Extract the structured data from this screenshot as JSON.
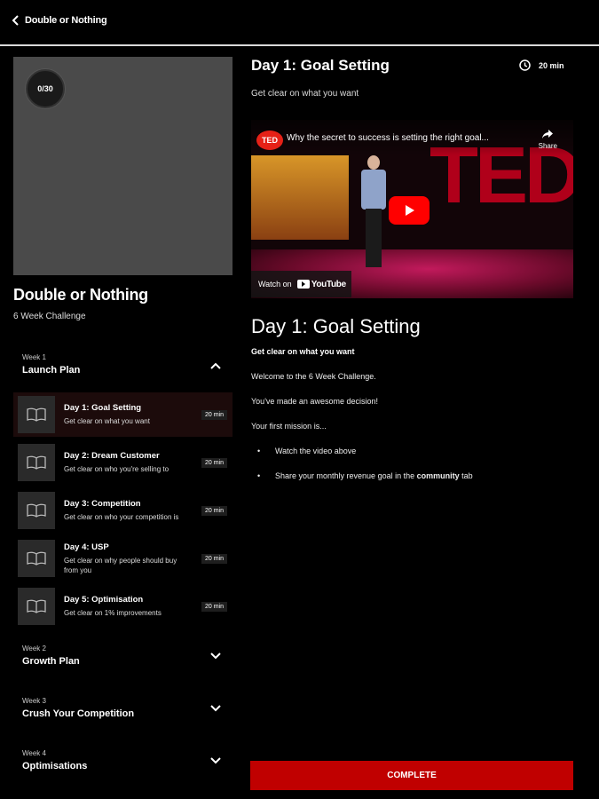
{
  "header": {
    "back_label": "Double or Nothing"
  },
  "course": {
    "progress_label": "0/30",
    "title": "Double or Nothing",
    "subtitle": "6 Week Challenge"
  },
  "weeks": [
    {
      "num": "Week 1",
      "name": "Launch Plan",
      "expanded": true
    },
    {
      "num": "Week 2",
      "name": "Growth Plan",
      "expanded": false
    },
    {
      "num": "Week 3",
      "name": "Crush Your Competition",
      "expanded": false
    },
    {
      "num": "Week 4",
      "name": "Optimisations",
      "expanded": false
    }
  ],
  "lessons": [
    {
      "title": "Day 1: Goal Setting",
      "desc": "Get clear on what you want",
      "duration": "20 min",
      "active": true
    },
    {
      "title": "Day 2: Dream Customer",
      "desc": "Get clear on who you're selling to",
      "duration": "20 min",
      "active": false
    },
    {
      "title": "Day 3: Competition",
      "desc": "Get clear on who your competition is",
      "duration": "20 min",
      "active": false
    },
    {
      "title": "Day 4: USP",
      "desc": "Get clear on why people should buy from you",
      "duration": "20 min",
      "active": false
    },
    {
      "title": "Day 5: Optimisation",
      "desc": "Get clear on 1% improvements",
      "duration": "20 min",
      "active": false
    }
  ],
  "detail": {
    "title": "Day 1: Goal Setting",
    "duration": "20 min",
    "subtitle": "Get clear on what you want",
    "video": {
      "channel_logo": "TED",
      "title": "Why the secret to success is setting the right goal...",
      "share_label": "Share",
      "watch_on_label": "Watch on",
      "youtube_label": "YouTube"
    },
    "body_title": "Day 1: Goal Setting",
    "body_strong": "Get clear on what you want",
    "paragraphs": [
      "Welcome to the 6 Week Challenge.",
      "You've made an awesome decision!",
      "Your first mission is..."
    ],
    "bullets": [
      "Watch the video above",
      "Share your monthly revenue goal in the",
      "community",
      "tab"
    ]
  },
  "complete_label": "COMPLETE",
  "colors": {
    "accent": "#c00000",
    "background": "#000000",
    "panel": "#4a4a4a"
  },
  "icons": {
    "back": "chevron-left-icon",
    "clock": "clock-icon",
    "lesson": "book-icon",
    "share": "share-icon",
    "play": "play-icon"
  }
}
